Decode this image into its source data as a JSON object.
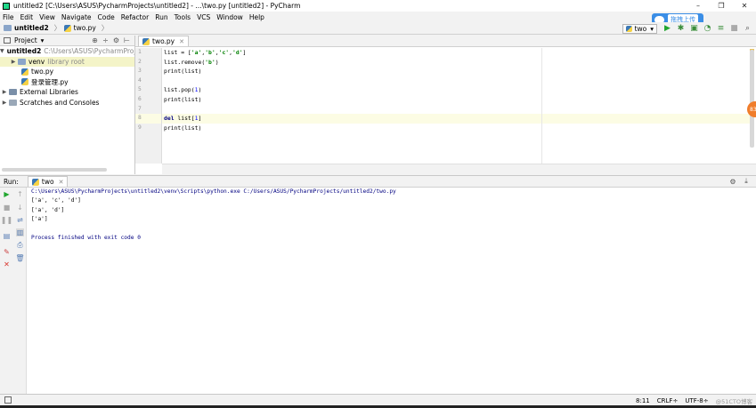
{
  "window": {
    "title": "untitled2 [C:\\Users\\ASUS\\PycharmProjects\\untitled2] - ...\\two.py [untitled2] - PyCharm",
    "minimize": "–",
    "restore": "❐",
    "close": "✕"
  },
  "menu": [
    "File",
    "Edit",
    "View",
    "Navigate",
    "Code",
    "Refactor",
    "Run",
    "Tools",
    "VCS",
    "Window",
    "Help"
  ],
  "breadcrumb": {
    "project": "untitled2",
    "file": "two.py"
  },
  "toolbar": {
    "run_config": "two",
    "dropdown": "▾"
  },
  "cloud_upload": {
    "label": "拖拽上传"
  },
  "project_panel": {
    "title": "Project",
    "tree": [
      {
        "name": "untitled2",
        "path": "C:\\Users\\ASUS\\PycharmProjects\\untitled2",
        "arrow": "▼",
        "type": "folder"
      },
      {
        "name": "venv",
        "note": "library root",
        "arrow": "▶",
        "type": "folder"
      },
      {
        "name": "two.py",
        "arrow": "",
        "type": "py"
      },
      {
        "name": "登录管理.py",
        "arrow": "",
        "type": "py"
      },
      {
        "name": "External Libraries",
        "arrow": "▶",
        "type": "lib"
      },
      {
        "name": "Scratches and Consoles",
        "arrow": "▶",
        "type": "scratch"
      }
    ]
  },
  "editor": {
    "tab": "two.py",
    "line_numbers": [
      "1",
      "2",
      "3",
      "4",
      "5",
      "6",
      "7",
      "8",
      "9"
    ],
    "current_line": 8,
    "badge": "83"
  },
  "run_panel": {
    "label": "Run:",
    "tab": "two",
    "output": [
      "C:\\Users\\ASUS\\PycharmProjects\\untitled2\\venv\\Scripts\\python.exe C:/Users/ASUS/PycharmProjects/untitled2/two.py",
      "['a', 'c', 'd']",
      "['a', 'd']",
      "['a']",
      "",
      "Process finished with exit code 0"
    ]
  },
  "status_bar": {
    "position": "8:11",
    "line_sep": "CRLF÷",
    "encoding": "UTF-8÷",
    "watermark": "@51CTO博客"
  },
  "colors": {
    "accent": "#3b8ee6",
    "string": "#008000",
    "keyword": "#000080",
    "run_green": "#21a62f",
    "stop_red": "#d9342b"
  }
}
